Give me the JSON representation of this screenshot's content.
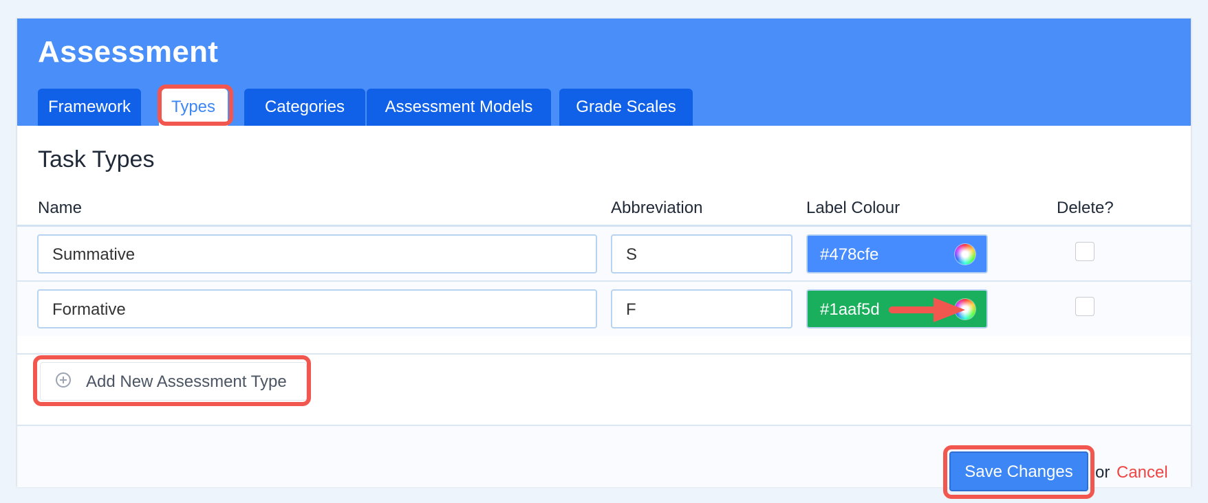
{
  "header": {
    "title": "Assessment",
    "tabs": [
      {
        "label": "Framework",
        "active": false
      },
      {
        "label": "Types",
        "active": true
      },
      {
        "label": "Categories",
        "active": false
      },
      {
        "label": "Assessment Models",
        "active": false
      },
      {
        "label": "Grade Scales",
        "active": false
      }
    ]
  },
  "section": {
    "title": "Task Types",
    "columns": [
      "Name",
      "Abbreviation",
      "Label Colour",
      "Delete?"
    ]
  },
  "rows": [
    {
      "name": "Summative",
      "abbreviation": "S",
      "colour": "#478cfe",
      "delete": false
    },
    {
      "name": "Formative",
      "abbreviation": "F",
      "colour": "#1aaf5d",
      "delete": false
    }
  ],
  "actions": {
    "add_label": "Add New Assessment Type",
    "save_label": "Save Changes",
    "or_text": "or",
    "cancel_label": "Cancel"
  },
  "colors": {
    "header_bg": "#4a8ff9",
    "tab_bg": "#1061e8",
    "highlight": "#f2574f",
    "cancel": "#ef4444"
  }
}
